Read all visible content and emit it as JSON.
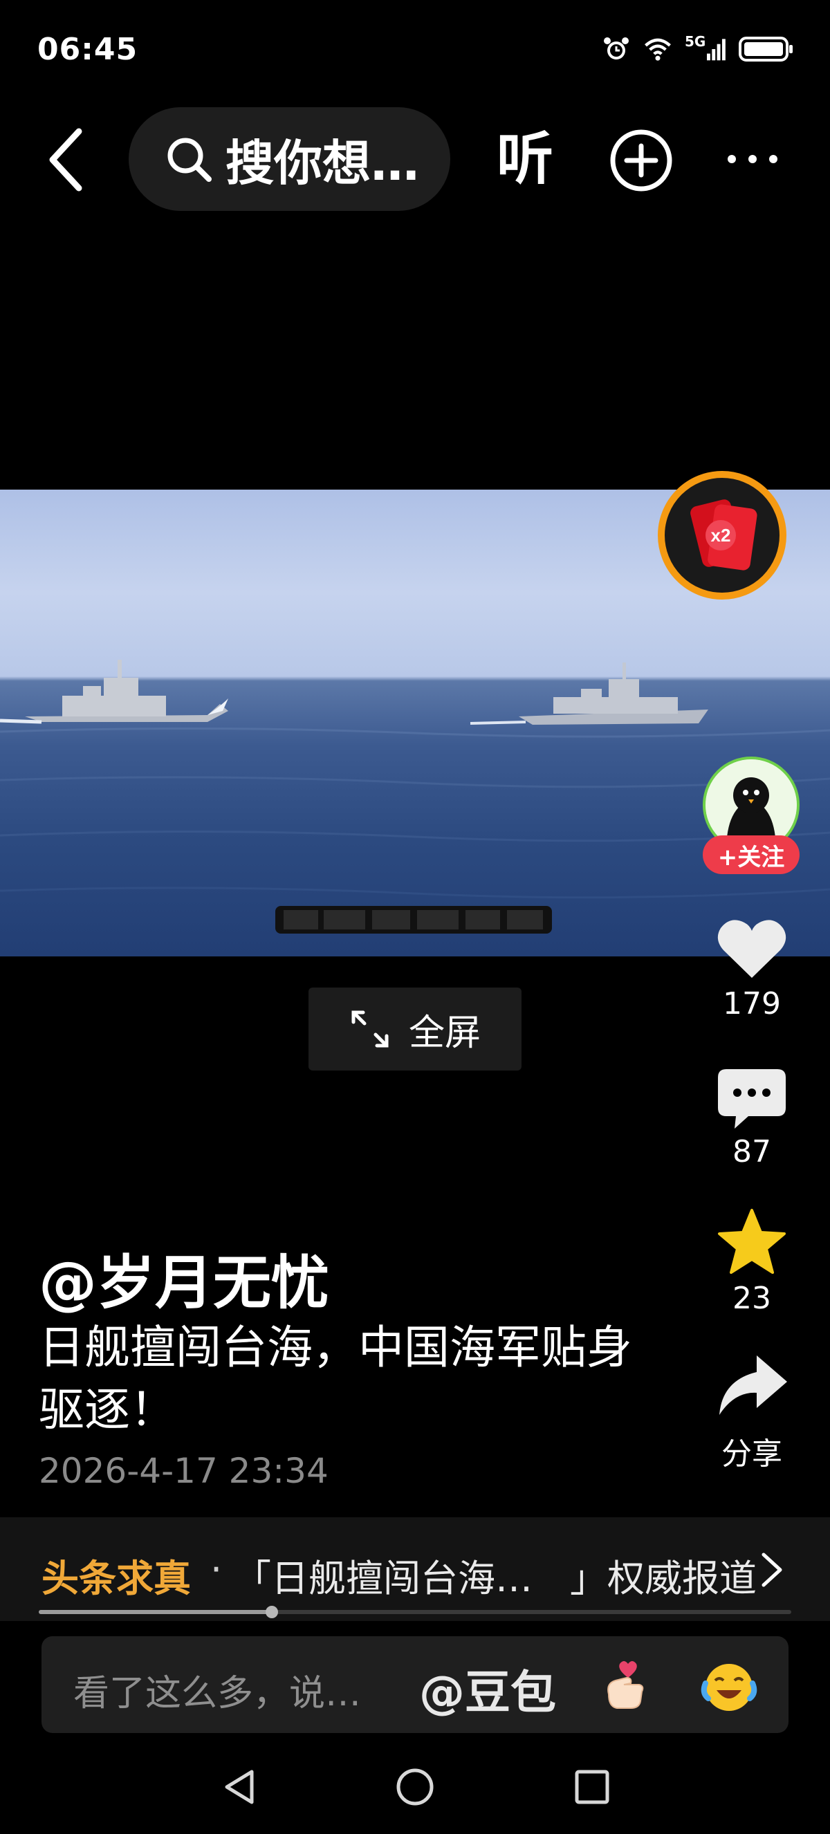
{
  "status_bar": {
    "time": "06:45",
    "network": "5G",
    "icons": [
      "alarm-icon",
      "wifi-icon",
      "signal-icon",
      "battery-icon"
    ]
  },
  "top_bar": {
    "search_placeholder": "搜你想…",
    "listen_label": "听",
    "icons": [
      "back-arrow-icon",
      "search-icon",
      "add-circle-icon",
      "more-icon"
    ]
  },
  "video": {
    "red_packet_badge": "x2",
    "fullscreen_label": "全屏"
  },
  "actions": {
    "follow_label": "+关注",
    "like_count": "179",
    "comment_count": "87",
    "favorite_count": "23",
    "share_label": "分享"
  },
  "post": {
    "author": "@岁月无忧",
    "title": "日舰擅闯台海，中国海军贴身驱逐！",
    "time": "2026-4-17 23:34"
  },
  "fact_check": {
    "tag": "头条求真",
    "separator": "·",
    "text": "「日舰擅闯台海…　」权威报道",
    "progress": 0.31
  },
  "comment_bar": {
    "placeholder": "看了这么多，说…",
    "mention": "@豆包",
    "emojis": [
      "heart-hand-emoji",
      "laughing-crying-emoji"
    ]
  },
  "colors": {
    "background": "#000000",
    "accent_follow": "#ee3c4a",
    "fact_tag": "#f0a838",
    "favorite_star": "#f6cb1b"
  }
}
